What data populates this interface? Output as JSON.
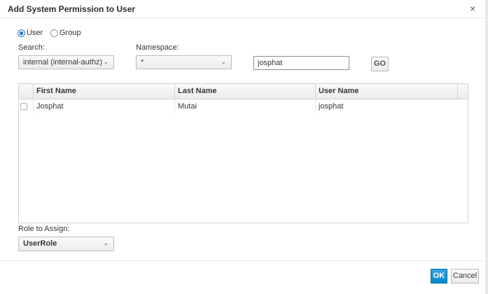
{
  "dialog": {
    "title": "Add System Permission to User",
    "close_symbol": "×"
  },
  "principal_type": {
    "options": [
      {
        "label": "User",
        "checked": true
      },
      {
        "label": "Group",
        "checked": false
      }
    ]
  },
  "search": {
    "label": "Search:",
    "selected": "internal (internal-authz)"
  },
  "namespace": {
    "label": "Namespace:",
    "selected": "*"
  },
  "query": {
    "value": "josphat",
    "go_label": "GO"
  },
  "table": {
    "columns": [
      "First Name",
      "Last Name",
      "User Name"
    ],
    "rows": [
      {
        "first_name": "Josphat",
        "last_name": "Mutai",
        "user_name": "josphat",
        "checked": false
      }
    ]
  },
  "role": {
    "label": "Role to Assign:",
    "selected": "UserRole"
  },
  "footer": {
    "ok_label": "OK",
    "cancel_label": "Cancel"
  },
  "colors": {
    "primary": "#0088ce",
    "radio_selected": "#2b7bc0"
  }
}
